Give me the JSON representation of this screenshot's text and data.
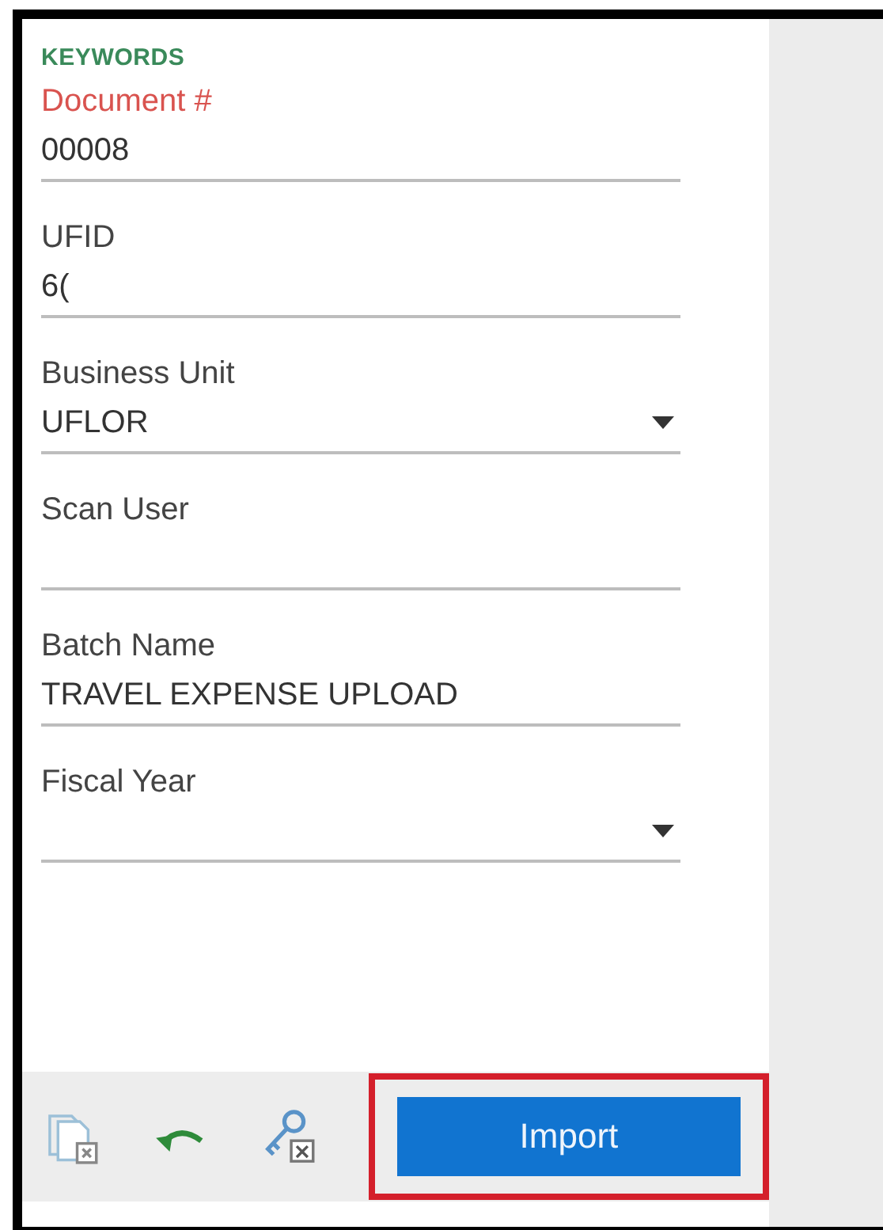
{
  "section_title": "KEYWORDS",
  "fields": [
    {
      "kind": "text",
      "label": "Document #",
      "value": "00008",
      "error": true
    },
    {
      "kind": "text",
      "label": "UFID",
      "value": "6(",
      "error": false
    },
    {
      "kind": "dropdown",
      "label": "Business Unit",
      "value": "UFLOR",
      "error": false
    },
    {
      "kind": "text",
      "label": "Scan User",
      "error": false
    },
    {
      "kind": "text",
      "label": "Batch Name",
      "value": "TRAVEL EXPENSE UPLOAD",
      "error": false
    },
    {
      "kind": "dropdown",
      "label": "Fiscal Year",
      "error": false
    }
  ],
  "toolbar": {
    "import_button": {
      "label": "Import",
      "highlighted": true
    }
  }
}
